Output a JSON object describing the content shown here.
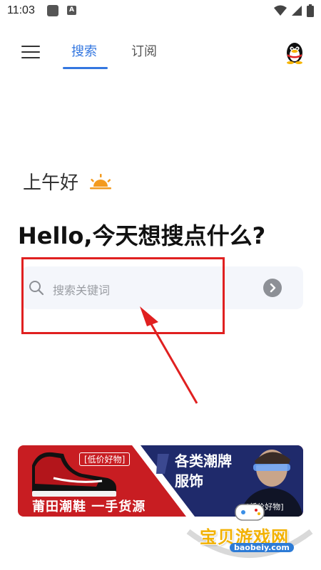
{
  "status_bar": {
    "time": "11:03"
  },
  "header": {
    "tabs": [
      {
        "label": "搜索",
        "active": true
      },
      {
        "label": "订阅",
        "active": false
      }
    ]
  },
  "greeting": "上午好",
  "headline": "Hello,今天想搜点什么?",
  "search": {
    "placeholder": "搜索关键词"
  },
  "banner": {
    "tag_left": "[低价好物]",
    "title_left": "莆田潮鞋 一手货源",
    "title_right_line1": "各类潮牌",
    "title_right_line2": "服饰",
    "tag_right": "[低价好物]"
  },
  "watermark": {
    "text": "宝贝游戏网",
    "url": "baobeiy.com"
  },
  "colors": {
    "accent": "#3477e0",
    "annotation": "#e02020",
    "banner_red": "#c81d22",
    "banner_navy": "#1f2a6b"
  },
  "icons": [
    "menu-icon",
    "qq-penguin-icon",
    "sun-icon",
    "search-icon",
    "chevron-right-icon",
    "wifi-icon",
    "signal-icon",
    "battery-icon"
  ]
}
